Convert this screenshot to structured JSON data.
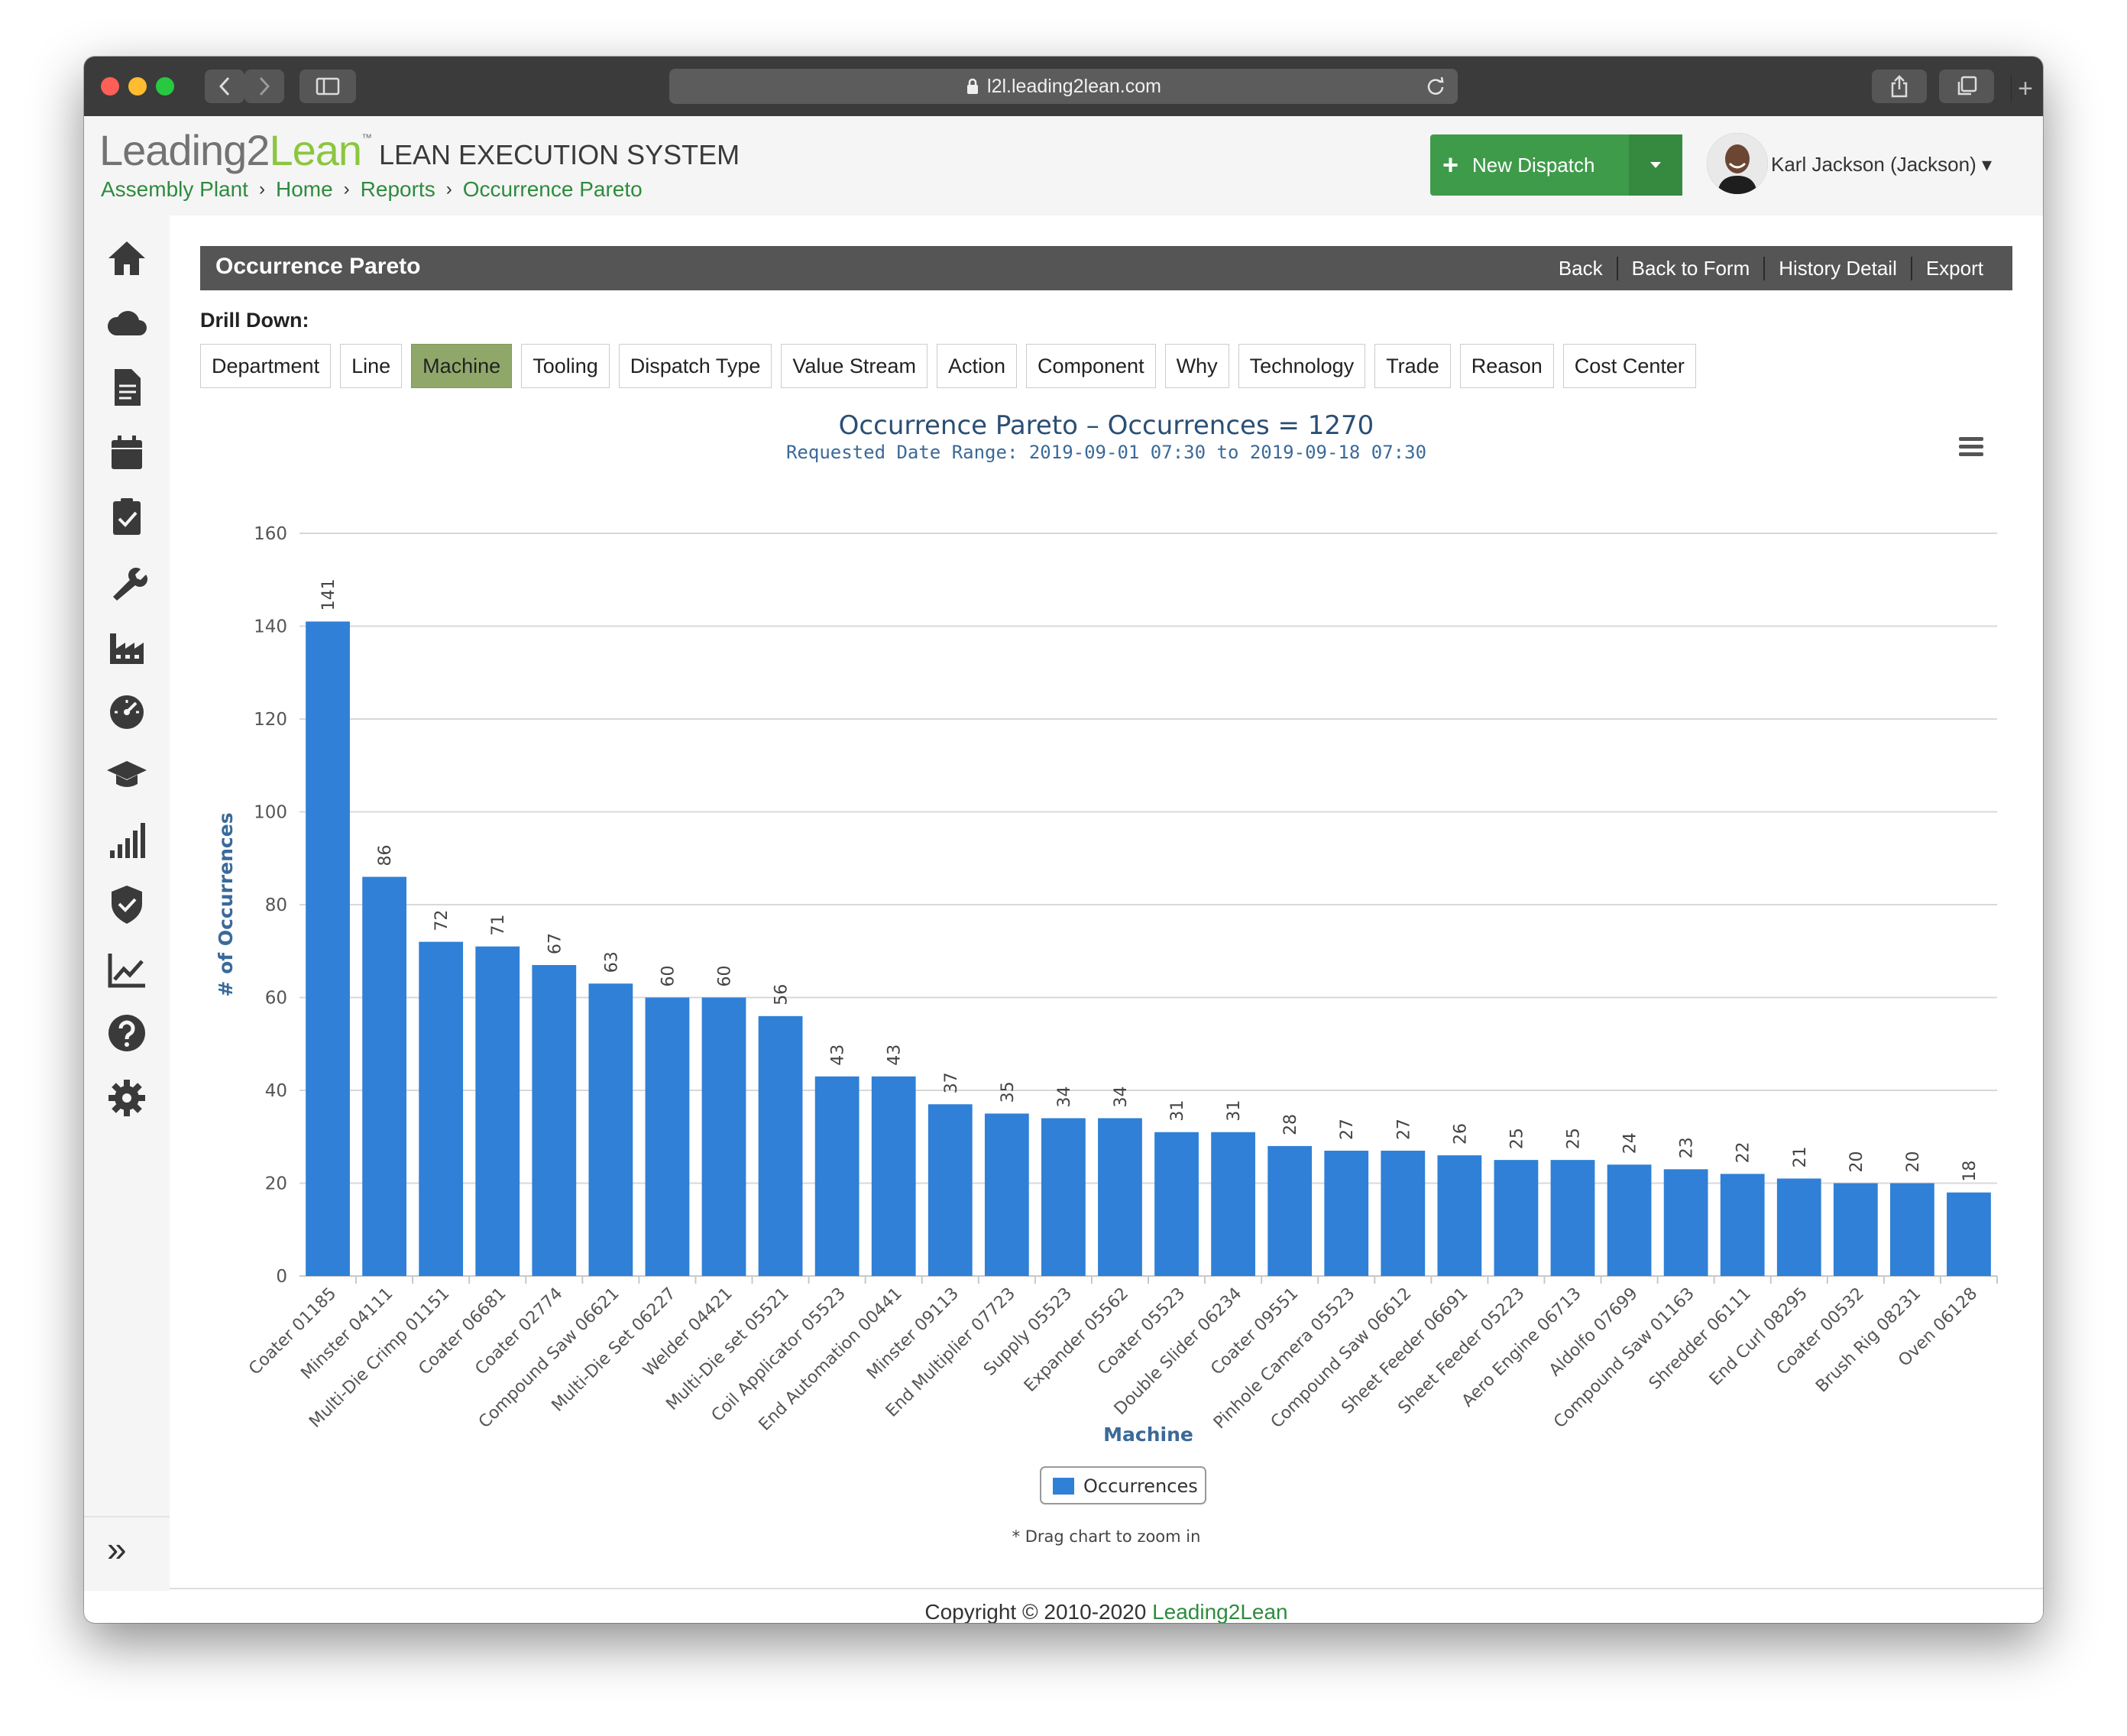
{
  "browser": {
    "url": "l2l.leading2lean.com"
  },
  "header": {
    "logo_main": "Leading2",
    "logo_accent": "Lean",
    "logo_tm": "™",
    "system_name": "LEAN EXECUTION SYSTEM",
    "breadcrumbs": [
      "Assembly Plant",
      "Home",
      "Reports",
      "Occurrence Pareto"
    ],
    "new_dispatch_label": "New Dispatch",
    "user_name": "Karl Jackson (Jackson)",
    "user_caret": "▾"
  },
  "sidebar": {
    "icons": [
      "home-icon",
      "cloud-icon",
      "document-icon",
      "calendar-icon",
      "clipboard-check-icon",
      "wrench-icon",
      "factory-icon",
      "dashboard-gauge-icon",
      "graduation-cap-icon",
      "signal-bars-icon",
      "shield-check-icon",
      "line-chart-icon",
      "help-icon",
      "gear-icon"
    ],
    "expand_label": "»"
  },
  "panel": {
    "title": "Occurrence Pareto",
    "links": [
      "Back",
      "Back to Form",
      "History Detail",
      "Export"
    ]
  },
  "drill_down": {
    "label": "Drill Down:",
    "buttons": [
      "Department",
      "Line",
      "Machine",
      "Tooling",
      "Dispatch Type",
      "Value Stream",
      "Action",
      "Component",
      "Why",
      "Technology",
      "Trade",
      "Reason",
      "Cost Center"
    ],
    "active": "Machine"
  },
  "colors": {
    "bar": "#2f80d6",
    "active_button": "#8fa86a",
    "brand_green": "#2e8b3e",
    "title_blue": "#2b4f74",
    "panel_bar": "#555555"
  },
  "chart_data": {
    "type": "bar",
    "title": "Occurrence Pareto – Occurrences = 1270",
    "subtitle": "Requested Date Range: 2019-09-01 07:30 to 2019-09-18 07:30",
    "xlabel": "Machine",
    "ylabel": "# of Occurrences",
    "ylim": [
      0,
      160
    ],
    "yticks": [
      0,
      20,
      40,
      60,
      80,
      100,
      120,
      140,
      160
    ],
    "grid": true,
    "legend_position": "bottom-center",
    "categories": [
      "Coater 01185",
      "Minster 04111",
      "Multi-Die Crimp 01151",
      "Coater 06681",
      "Coater 02774",
      "Compound Saw 06621",
      "Multi-Die Set 06227",
      "Welder 04421",
      "Multi-Die set 05521",
      "Coil Applicator 05523",
      "End Automation 00441",
      "Minster 09113",
      "End Multiplier 07723",
      "Supply 05523",
      "Expander 05562",
      "Coater 05523",
      "Double Slider 06234",
      "Coater 09551",
      "Pinhole Camera 05523",
      "Compound Saw 06612",
      "Sheet Feeder 06691",
      "Sheet Feeder 05223",
      "Aero Engine 06713",
      "Aldolfo 07699",
      "Compound Saw 01163",
      "Shredder 06111",
      "End Curl 08295",
      "Coater 00532",
      "Brush Rig 08231",
      "Oven 06128"
    ],
    "series": [
      {
        "name": "Occurrences",
        "values": [
          141,
          86,
          72,
          71,
          67,
          63,
          60,
          60,
          56,
          43,
          43,
          37,
          35,
          34,
          34,
          31,
          31,
          28,
          27,
          27,
          26,
          25,
          25,
          24,
          23,
          22,
          21,
          20,
          20,
          18
        ]
      }
    ],
    "note": "* Drag chart to zoom in",
    "menu_icon": "hamburger-menu-icon"
  },
  "footer": {
    "copyright": "Copyright © 2010-2020",
    "brand": "Leading2Lean"
  }
}
